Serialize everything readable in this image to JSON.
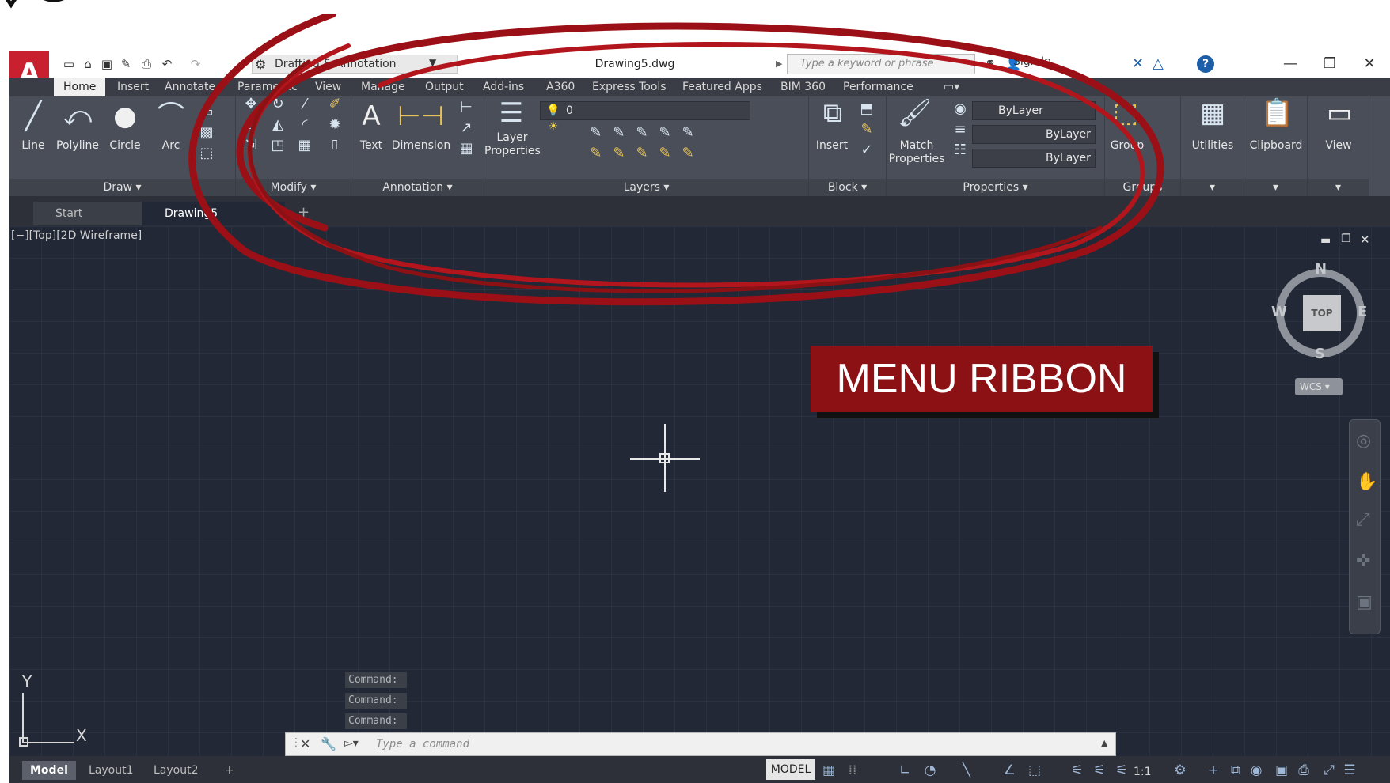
{
  "titlebar": {
    "app_logo_letter": "A",
    "workspace": "Drafting & Annotation",
    "document_title": "Drawing5.dwg",
    "search_placeholder": "Type a keyword or phrase",
    "sign_in": "Sign In",
    "help_icon": "help-icon"
  },
  "ribbon_tabs": [
    "Home",
    "Insert",
    "Annotate",
    "Parametric",
    "View",
    "Manage",
    "Output",
    "Add-ins",
    "A360",
    "Express Tools",
    "Featured Apps",
    "BIM 360",
    "Performance"
  ],
  "panels": {
    "draw": {
      "title": "Draw",
      "tools": [
        "Line",
        "Polyline",
        "Circle",
        "Arc"
      ]
    },
    "modify": {
      "title": "Modify"
    },
    "annotation": {
      "title": "Annotation",
      "tools": [
        "Text",
        "Dimension"
      ]
    },
    "layers": {
      "title": "Layers",
      "tool": "Layer Properties",
      "current_layer": "0"
    },
    "block": {
      "title": "Block",
      "tool": "Insert"
    },
    "properties": {
      "title": "Properties",
      "tool": "Match Properties",
      "color": "ByLayer",
      "linetype": "ByLayer",
      "lineweight": "ByLayer"
    },
    "groups": {
      "title": "Groups",
      "tool": "Group"
    },
    "utilities": {
      "tool": "Utilities"
    },
    "clipboard": {
      "tool": "Clipboard"
    },
    "view": {
      "tool": "View"
    }
  },
  "doc_tabs": [
    "Start",
    "Drawing5"
  ],
  "viewport_label": "[−][Top][2D Wireframe]",
  "viewcube": {
    "top": "TOP",
    "north": "N",
    "south": "S",
    "east": "E",
    "west": "W",
    "wcs": "WCS"
  },
  "ucs": {
    "x": "X",
    "y": "Y"
  },
  "command_history": [
    "Command:",
    "Command:",
    "Command:"
  ],
  "command_placeholder": "Type a command",
  "layout_tabs": [
    "Model",
    "Layout1",
    "Layout2"
  ],
  "status": {
    "model": "MODEL",
    "scale": "1:1"
  },
  "annotation_callout": "MENU RIBBON",
  "colors": {
    "accent_red": "#8c1114",
    "autocad_red": "#c8202f",
    "ribbon_bg": "#4a4e58",
    "canvas_bg": "#222835"
  }
}
